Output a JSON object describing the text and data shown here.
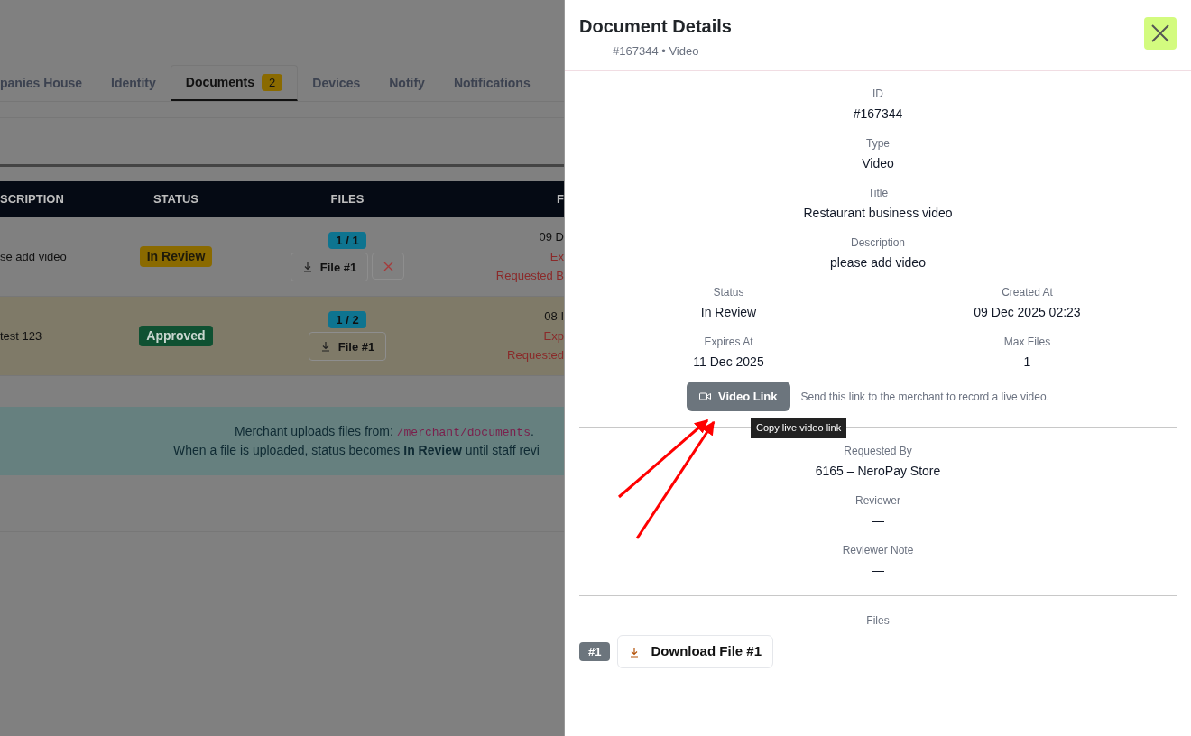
{
  "tabs": [
    {
      "label": "panies House",
      "selected": false
    },
    {
      "label": "Identity",
      "selected": false
    },
    {
      "label": "Documents",
      "badge": "2",
      "selected": true
    },
    {
      "label": "Devices",
      "selected": false
    },
    {
      "label": "Notify",
      "selected": false
    },
    {
      "label": "Notifications",
      "selected": false
    }
  ],
  "table": {
    "columns": [
      "SCRIPTION",
      "STATUS",
      "FILES",
      "F"
    ],
    "rows": [
      {
        "description": "se add video",
        "status": {
          "label": "In Review",
          "kind": "review"
        },
        "files_count": "1 / 1",
        "files": [
          "File #1"
        ],
        "removable": true,
        "highlighted": false,
        "date": "09 D",
        "expires": "Ex",
        "requested_by": "Requested B"
      },
      {
        "description": "test 123",
        "status": {
          "label": "Approved",
          "kind": "approved"
        },
        "files_count": "1 / 2",
        "files": [
          "File #1"
        ],
        "removable": false,
        "highlighted": true,
        "date": "08 I",
        "expires": "Exp",
        "requested_by": "Requested"
      }
    ]
  },
  "info": {
    "line_1_prefix": "Merchant uploads files from:",
    "path": "/merchant/documents",
    "line_1_suffix": ".",
    "line_2": "When a file is uploaded, status becomes **In Review** until staff revi"
  },
  "panel": {
    "title": "Document Details",
    "subtitle": "#167344 • Video",
    "fields": [
      {
        "label": "ID",
        "value": "#167344"
      },
      {
        "label": "Type",
        "value": "Video"
      },
      {
        "label": "Title",
        "value": "Restaurant business video"
      },
      {
        "label": "Description",
        "value": "please add video"
      }
    ],
    "grid": [
      {
        "label": "Status",
        "value": "In Review"
      },
      {
        "label": "Created At",
        "value": "09 Dec 2025 02:23"
      },
      {
        "label": "Expires At",
        "value": "11 Dec 2025"
      },
      {
        "label": "Max Files",
        "value": "1"
      }
    ],
    "video_link": {
      "label": "Video Link",
      "hint": "Send this link to the merchant to record a live video.",
      "tooltip": "Copy live video link"
    },
    "people": [
      {
        "label": "Requested By",
        "value": "6165 – NeroPay Store"
      },
      {
        "label": "Reviewer",
        "value": "—"
      },
      {
        "label": "Reviewer Note",
        "value": "—"
      }
    ],
    "files_label": "Files",
    "files": [
      {
        "badge": "#1",
        "label": "Download File #1"
      }
    ]
  }
}
